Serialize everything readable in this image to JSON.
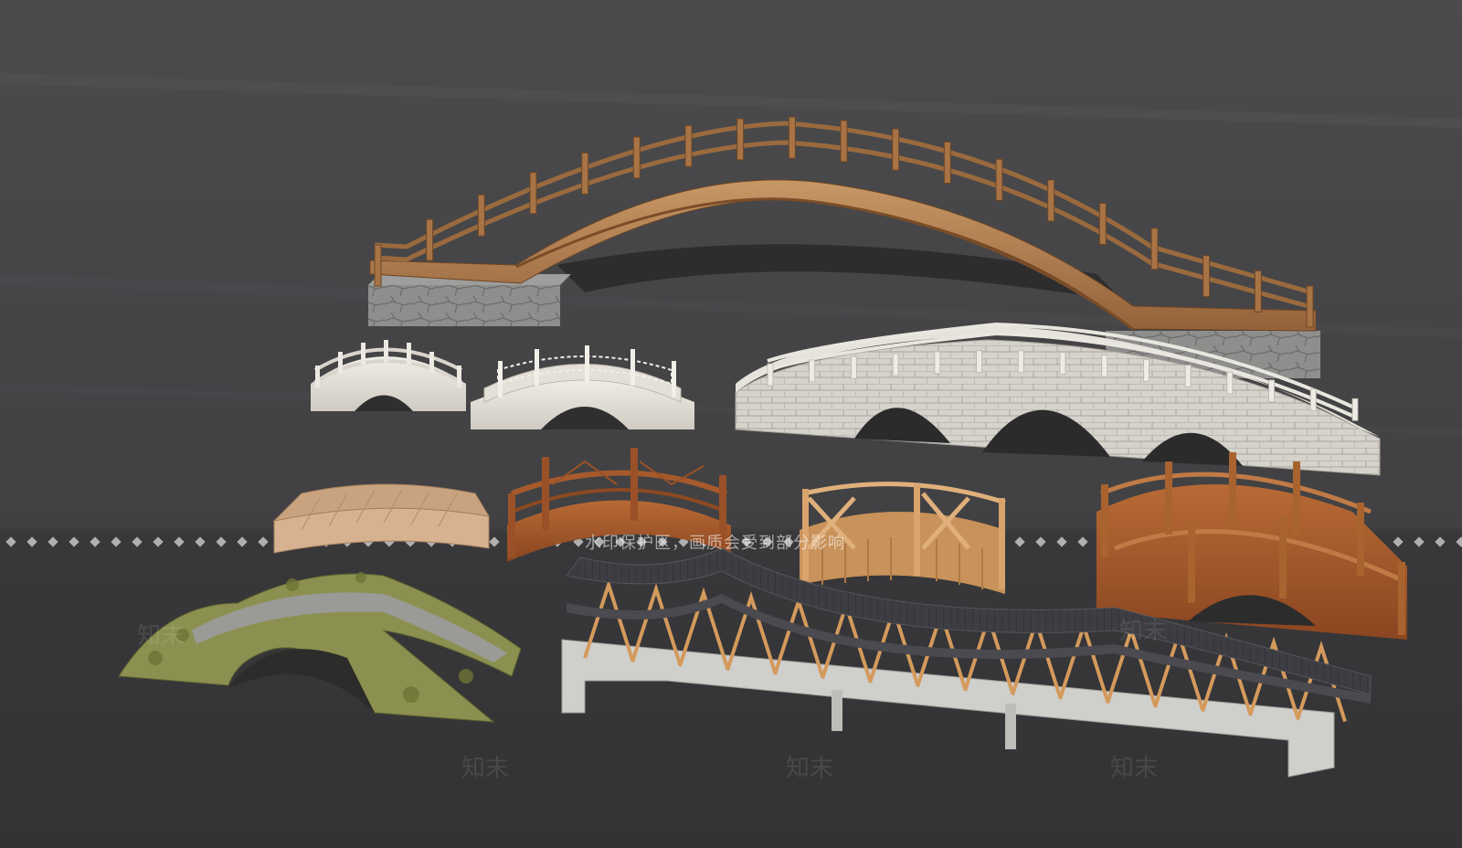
{
  "watermark": {
    "banner_text": "水印保护区，画质会受到部分影响",
    "tile_text": "知末"
  },
  "colors": {
    "background_top": "#4a4a4c",
    "background_bottom": "#353537",
    "wood_light": "#b98a5a",
    "wood_dark": "#8a5a30",
    "wood_red": "#a0562a",
    "stone_white": "#e8e4dc",
    "stone_grey": "#8a8a88",
    "roof_tile": "#3c3c42",
    "concrete": "#c8c8c6",
    "moss_stone": "#8a8f4a"
  }
}
